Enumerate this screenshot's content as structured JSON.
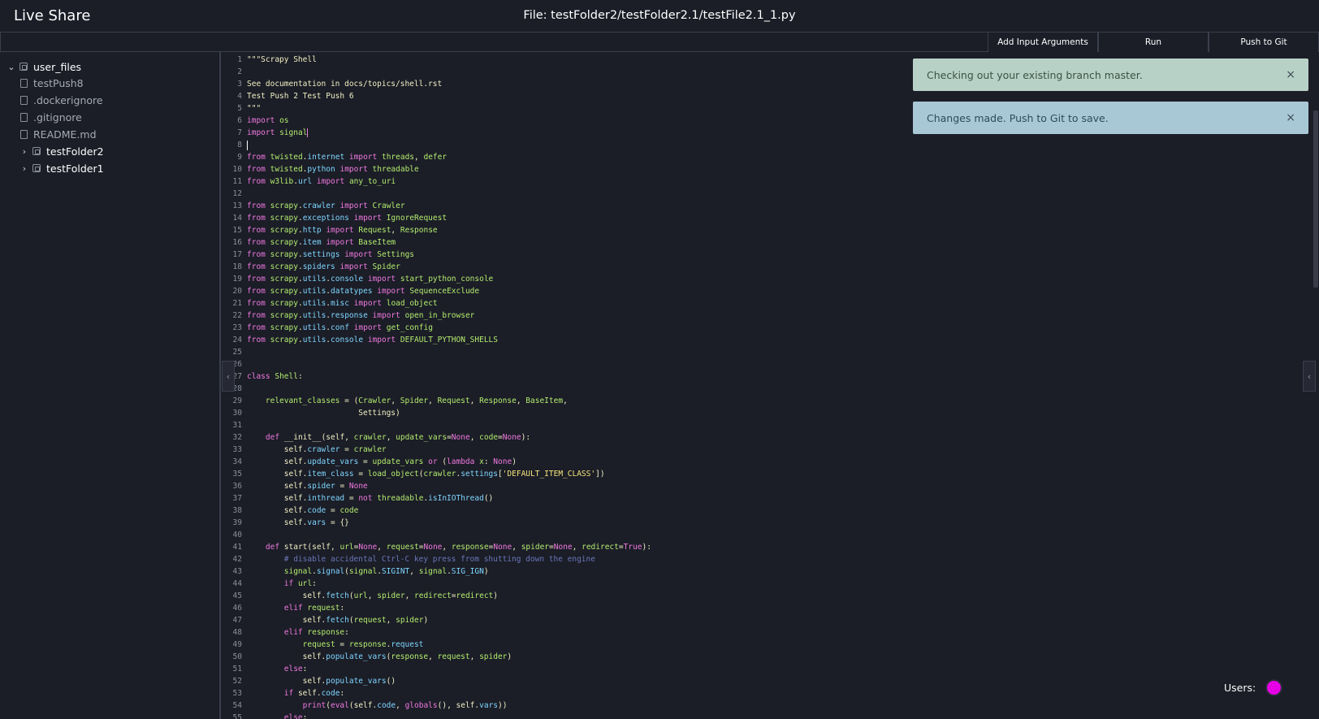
{
  "header": {
    "app_title": "Live Share",
    "file_title": "File: testFolder2/testFolder2.1/testFile2.1_1.py"
  },
  "toolbar": {
    "add_args_label": "Add Input Arguments",
    "run_label": "Run",
    "push_label": "Push to Git"
  },
  "sidebar": {
    "root": "user_files",
    "files": [
      "testPush8",
      ".dockerignore",
      ".gitignore",
      "README.md"
    ],
    "folders": [
      "testFolder2",
      "testFolder1"
    ]
  },
  "toasts": [
    {
      "message": "Checking out your existing branch master.",
      "close": "×"
    },
    {
      "message": "Changes made. Push to Git to save.",
      "close": "×"
    }
  ],
  "users": {
    "label": "Users:",
    "avatar_color": "#e600e6"
  },
  "editor": {
    "collapse_left": "‹",
    "collapse_right": "‹",
    "lines": [
      "\"\"\"Scrapy Shell",
      "",
      "See documentation in docs/topics/shell.rst",
      "Test Push 2 Test Push 6",
      "\"\"\"",
      "import os",
      "import signal",
      "",
      "from twisted.internet import threads, defer",
      "from twisted.python import threadable",
      "from w3lib.url import any_to_uri",
      "",
      "from scrapy.crawler import Crawler",
      "from scrapy.exceptions import IgnoreRequest",
      "from scrapy.http import Request, Response",
      "from scrapy.item import BaseItem",
      "from scrapy.settings import Settings",
      "from scrapy.spiders import Spider",
      "from scrapy.utils.console import start_python_console",
      "from scrapy.utils.datatypes import SequenceExclude",
      "from scrapy.utils.misc import load_object",
      "from scrapy.utils.response import open_in_browser",
      "from scrapy.utils.conf import get_config",
      "from scrapy.utils.console import DEFAULT_PYTHON_SHELLS",
      "",
      "",
      "class Shell:",
      "",
      "    relevant_classes = (Crawler, Spider, Request, Response, BaseItem,",
      "                        Settings)",
      "",
      "    def __init__(self, crawler, update_vars=None, code=None):",
      "        self.crawler = crawler",
      "        self.update_vars = update_vars or (lambda x: None)",
      "        self.item_class = load_object(crawler.settings['DEFAULT_ITEM_CLASS'])",
      "        self.spider = None",
      "        self.inthread = not threadable.isInIOThread()",
      "        self.code = code",
      "        self.vars = {}",
      "",
      "    def start(self, url=None, request=None, response=None, spider=None, redirect=True):",
      "        # disable accidental Ctrl-C key press from shutting down the engine",
      "        signal.signal(signal.SIGINT, signal.SIG_IGN)",
      "        if url:",
      "            self.fetch(url, spider, redirect=redirect)",
      "        elif request:",
      "            self.fetch(request, spider)",
      "        elif response:",
      "            request = response.request",
      "            self.populate_vars(response, request, spider)",
      "        else:",
      "            self.populate_vars()",
      "        if self.code:",
      "            print(eval(self.code, globals(), self.vars))",
      "        else:"
    ]
  }
}
